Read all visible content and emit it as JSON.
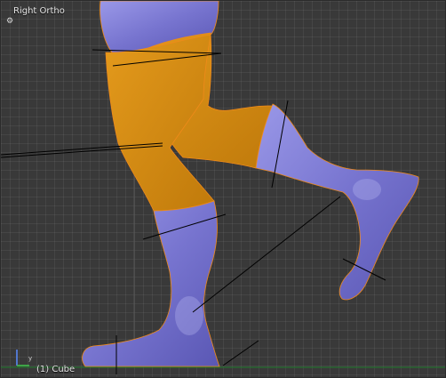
{
  "viewport": {
    "title": "Right Ortho",
    "object_label": "(1) Cube",
    "axis_label": "y",
    "options_icon": "gear-icon"
  },
  "colors": {
    "background": "#393939",
    "mesh_blue": "#7d7ad6",
    "mesh_orange": "#d98c12",
    "selection_outline": "#f08a1a",
    "ground_line": "#1f7a2a"
  }
}
